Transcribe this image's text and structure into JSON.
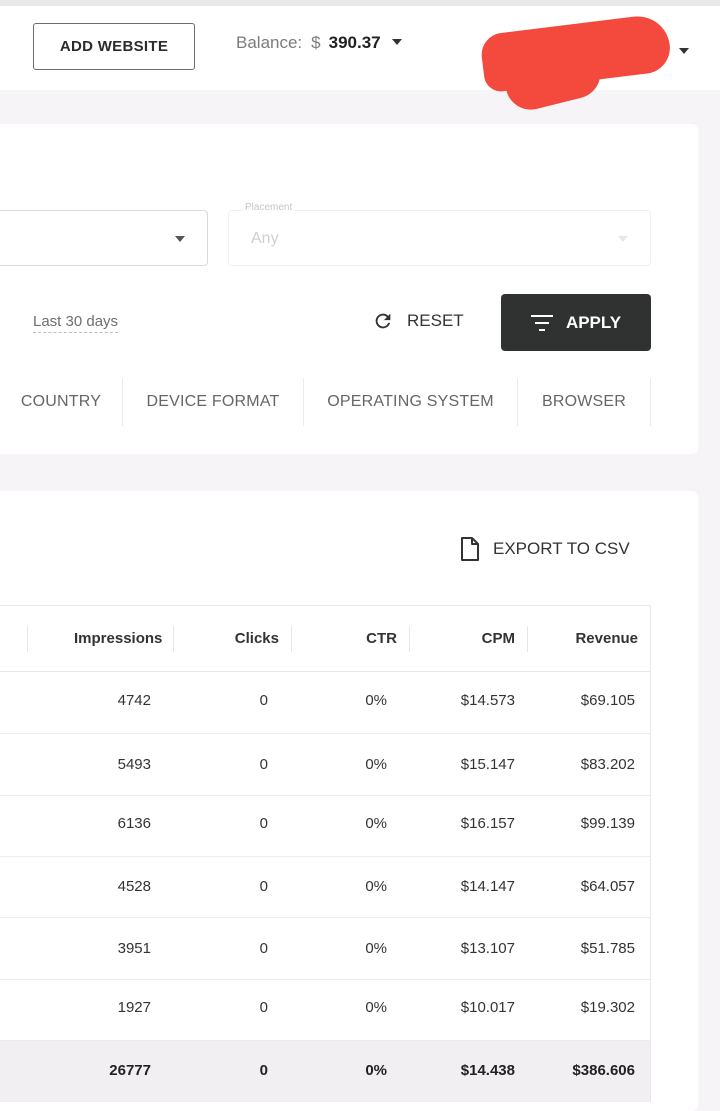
{
  "header": {
    "add_website_label": "ADD WEBSITE",
    "balance_label": "Balance:",
    "currency_symbol": "$",
    "balance_amount": "390.37"
  },
  "filters": {
    "placement_label": "Placement",
    "placement_value": "Any",
    "date_range": "Last 30 days",
    "reset_label": "RESET",
    "apply_label": "APPLY"
  },
  "tabs": [
    "COUNTRY",
    "DEVICE FORMAT",
    "OPERATING SYSTEM",
    "BROWSER"
  ],
  "report": {
    "export_label": "EXPORT TO CSV",
    "columns": [
      "Impressions",
      "Clicks",
      "CTR",
      "CPM",
      "Revenue"
    ],
    "rows": [
      {
        "impressions": "4742",
        "clicks": "0",
        "ctr": "0%",
        "cpm": "$14.573",
        "revenue": "$69.105"
      },
      {
        "impressions": "5493",
        "clicks": "0",
        "ctr": "0%",
        "cpm": "$15.147",
        "revenue": "$83.202"
      },
      {
        "impressions": "6136",
        "clicks": "0",
        "ctr": "0%",
        "cpm": "$16.157",
        "revenue": "$99.139"
      },
      {
        "impressions": "4528",
        "clicks": "0",
        "ctr": "0%",
        "cpm": "$14.147",
        "revenue": "$64.057"
      },
      {
        "impressions": "3951",
        "clicks": "0",
        "ctr": "0%",
        "cpm": "$13.107",
        "revenue": "$51.785"
      },
      {
        "impressions": "1927",
        "clicks": "0",
        "ctr": "0%",
        "cpm": "$10.017",
        "revenue": "$19.302"
      }
    ],
    "total": {
      "impressions": "26777",
      "clicks": "0",
      "ctr": "0%",
      "cpm": "$14.438",
      "revenue": "$386.606"
    }
  },
  "colors": {
    "apply_bg": "#2f3230",
    "redaction": "#f44a3e",
    "page_bg": "#f6f4f6"
  }
}
